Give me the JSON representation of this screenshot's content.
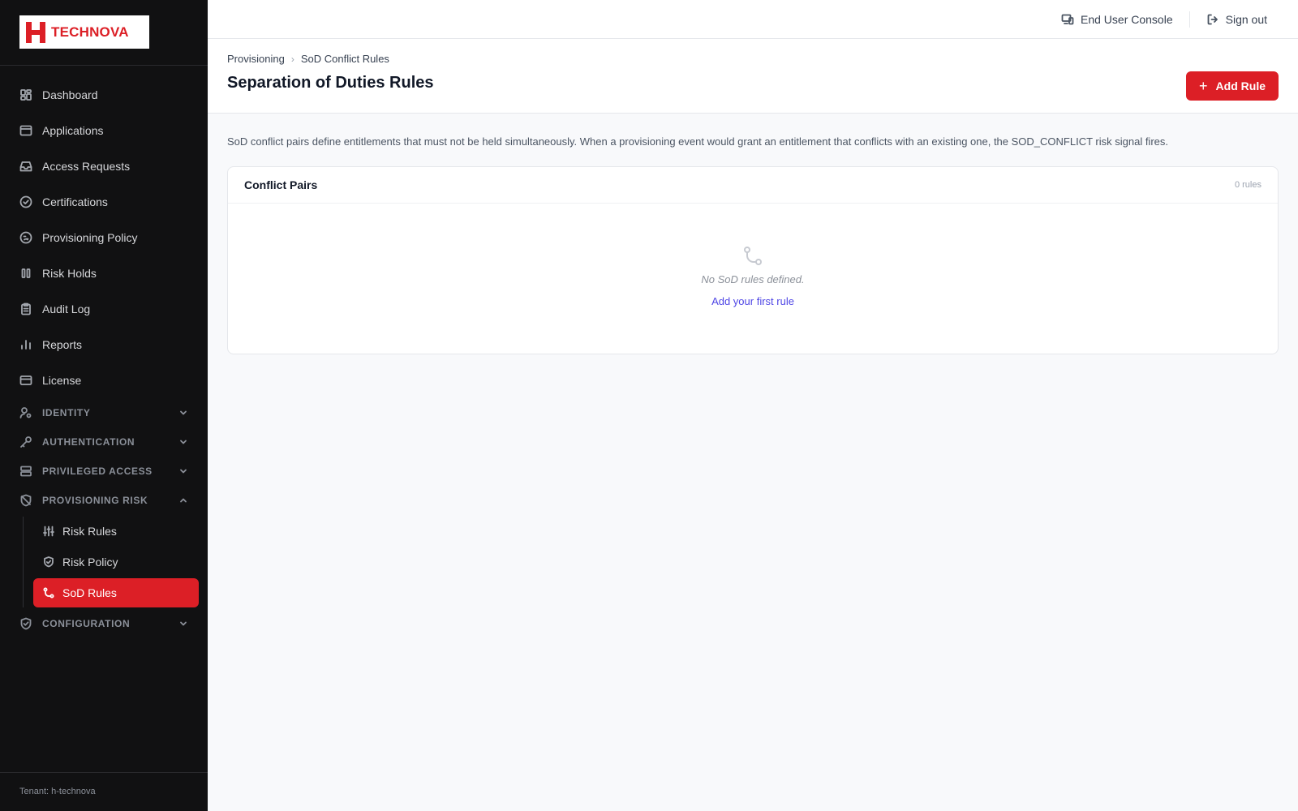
{
  "brand": {
    "name": "TECHNOVA",
    "accent": "#dc1f26"
  },
  "sidebar": {
    "items": [
      {
        "label": "Dashboard",
        "icon": "dashboard-icon"
      },
      {
        "label": "Applications",
        "icon": "window-icon"
      },
      {
        "label": "Access Requests",
        "icon": "inbox-icon"
      },
      {
        "label": "Certifications",
        "icon": "check-circle-icon"
      },
      {
        "label": "Provisioning Policy",
        "icon": "policy-icon"
      },
      {
        "label": "Risk Holds",
        "icon": "pause-icon"
      },
      {
        "label": "Audit Log",
        "icon": "clipboard-icon"
      },
      {
        "label": "Reports",
        "icon": "bar-chart-icon"
      },
      {
        "label": "License",
        "icon": "card-icon"
      }
    ],
    "groups": [
      {
        "label": "Identity",
        "icon": "user-gear-icon"
      },
      {
        "label": "Authentication",
        "icon": "key-icon"
      },
      {
        "label": "Privileged Access",
        "icon": "server-icon"
      },
      {
        "label": "Provisioning Risk",
        "icon": "shield-off-icon"
      },
      {
        "label": "Configuration",
        "icon": "shield-check-icon"
      }
    ],
    "sub_items": [
      {
        "label": "Risk Rules",
        "icon": "sliders-icon"
      },
      {
        "label": "Risk Policy",
        "icon": "shield-check-icon"
      },
      {
        "label": "SoD Rules",
        "icon": "git-branch-icon",
        "active": true
      }
    ],
    "tenant": "Tenant: h-technova"
  },
  "topbar": {
    "console_label": "End User Console",
    "signout_label": "Sign out"
  },
  "header": {
    "breadcrumb": [
      "Provisioning",
      "SoD Conflict Rules"
    ],
    "title": "Separation of Duties Rules",
    "add_label": "Add Rule"
  },
  "main": {
    "description": "SoD conflict pairs define entitlements that must not be held simultaneously. When a provisioning event would grant an entitlement that conflicts with an existing one, the SOD_CONFLICT risk signal fires.",
    "card": {
      "title": "Conflict Pairs",
      "count": "0 rules",
      "empty_text": "No SoD rules defined.",
      "empty_link": "Add your first rule"
    }
  }
}
